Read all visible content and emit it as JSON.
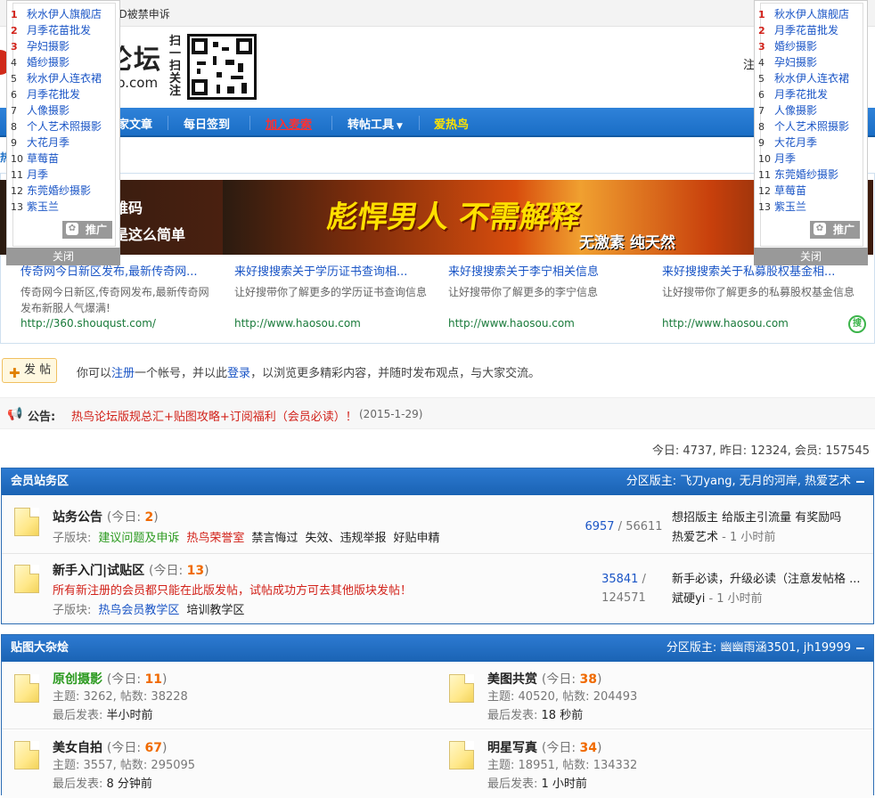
{
  "topbar": {
    "text": "ID被禁申诉"
  },
  "header": {
    "logo_text": "论坛",
    "logo_sub": "iao.com",
    "qr_side": "扫一扫关注",
    "right_text": "注"
  },
  "nav": {
    "items": [
      "家文章",
      "每日签到",
      "加入麦索",
      "转帖工具",
      "爱热鸟"
    ]
  },
  "hot_label": "热",
  "float_left": {
    "items": [
      {
        "n": "1",
        "label": "秋水伊人旗舰店"
      },
      {
        "n": "2",
        "label": "月季花苗批发"
      },
      {
        "n": "3",
        "label": "孕妇摄影"
      },
      {
        "n": "4",
        "label": "婚纱摄影"
      },
      {
        "n": "5",
        "label": "秋水伊人连衣裙"
      },
      {
        "n": "6",
        "label": "月季花批发"
      },
      {
        "n": "7",
        "label": "人像摄影"
      },
      {
        "n": "8",
        "label": "个人艺术照摄影"
      },
      {
        "n": "9",
        "label": "大花月季"
      },
      {
        "n": "10",
        "label": "草莓苗"
      },
      {
        "n": "11",
        "label": "月季"
      },
      {
        "n": "12",
        "label": "东莞婚纱摄影"
      },
      {
        "n": "13",
        "label": "紫玉兰"
      }
    ],
    "promo": "推广",
    "close": "关闭"
  },
  "float_right": {
    "items": [
      {
        "n": "1",
        "label": "秋水伊人旗舰店"
      },
      {
        "n": "2",
        "label": "月季花苗批发"
      },
      {
        "n": "3",
        "label": "婚纱摄影"
      },
      {
        "n": "4",
        "label": "孕妇摄影"
      },
      {
        "n": "5",
        "label": "秋水伊人连衣裙"
      },
      {
        "n": "6",
        "label": "月季花批发"
      },
      {
        "n": "7",
        "label": "人像摄影"
      },
      {
        "n": "8",
        "label": "个人艺术照摄影"
      },
      {
        "n": "9",
        "label": "大花月季"
      },
      {
        "n": "10",
        "label": "月季"
      },
      {
        "n": "11",
        "label": "东莞婚纱摄影"
      },
      {
        "n": "12",
        "label": "草莓苗"
      },
      {
        "n": "13",
        "label": "紫玉兰"
      }
    ],
    "promo": "推广",
    "close": "关闭"
  },
  "banner": {
    "left_line1": "扫描二维码",
    "left_line2": "性福就是这么简单",
    "headline": "彪悍男人 不需解释",
    "tag": "无激素 纯天然"
  },
  "ads": [
    {
      "title": "传奇网今日新区发布,最新传奇网...",
      "desc": "传奇网今日新区,传奇网发布,最新传奇网发布新服人气爆满!",
      "url": "http://360.shouqust.com/"
    },
    {
      "title": "来好搜搜索关于学历证书查询相...",
      "desc": "让好搜带你了解更多的学历证书查询信息",
      "url": "http://www.haosou.com"
    },
    {
      "title": "来好搜搜索关于李宁相关信息",
      "desc": "让好搜带你了解更多的李宁信息",
      "url": "http://www.haosou.com"
    },
    {
      "title": "来好搜搜索关于私募股权基金相...",
      "desc": "让好搜带你了解更多的私募股权基金信息",
      "url": "http://www.haosou.com"
    }
  ],
  "so_icon": "搜",
  "post": {
    "button": "发 帖",
    "pre": "你可以",
    "register": "注册",
    "mid": "一个帐号，并以此",
    "login": "登录",
    "post": "，以浏览更多精彩内容，并随时发布观点，与大家交流。"
  },
  "notice": {
    "label": "公告:",
    "text": "热鸟论坛版规总汇+贴图攻略+订阅福利（会员必读）！",
    "date": "(2015-1-29)"
  },
  "stats": "今日: 4737, 昨日: 12324, 会员: 157545",
  "section1": {
    "title": "会员站务区",
    "mods_label": "分区版主:",
    "mods": "飞刀yang, 无月的河岸, 热爱艺术",
    "forums": [
      {
        "name": "站务公告",
        "today_label": "(今日: ",
        "today": "2",
        "today_end": ")",
        "sub_label": "子版块:",
        "subs": [
          "建议问题及申诉",
          "热鸟荣誉室",
          "禁言悔过",
          "失效、违规举报",
          "好贴申精"
        ],
        "threads": "6957",
        "posts": "56611",
        "last_title": "想招版主 给版主引流量 有奖励吗",
        "last_user": "热爱艺术",
        "last_time": "- 1 小时前"
      },
      {
        "name": "新手入门|试贴区",
        "today_label": "(今日: ",
        "today": "13",
        "today_end": ")",
        "note": "所有新注册的会员都只能在此版发帖，试帖成功方可去其他版块发帖！",
        "sub_label": "子版块:",
        "subs": [
          "热鸟会员教学区",
          "培训教学区"
        ],
        "threads": "35841",
        "posts": "124571",
        "last_title": "新手必读，升级必读（注意发帖格 ...",
        "last_user": "斌硬yi",
        "last_time": "- 1 小时前"
      }
    ]
  },
  "section2": {
    "title": "贴图大杂烩",
    "mods_label": "分区版主:",
    "mods": "幽幽雨涵3501, jh19999",
    "forums": [
      {
        "name": "原创摄影",
        "today": "11",
        "topics_label": "主题:",
        "topics": "3262",
        "posts_label": "帖数:",
        "posts": "38228",
        "last_label": "最后发表:",
        "last": "半小时前"
      },
      {
        "name": "美图共赏",
        "today": "38",
        "topics_label": "主题:",
        "topics": "40520",
        "posts_label": "帖数:",
        "posts": "204493",
        "last_label": "最后发表:",
        "last": "18 秒前"
      },
      {
        "name": "美女自拍",
        "today": "67",
        "topics_label": "主题:",
        "topics": "3557",
        "posts_label": "帖数:",
        "posts": "295095",
        "last_label": "最后发表:",
        "last": "8 分钟前"
      },
      {
        "name": "明星写真",
        "today": "34",
        "topics_label": "主题:",
        "topics": "18951",
        "posts_label": "帖数:",
        "posts": "134332",
        "last_label": "最后发表:",
        "last": "1 小时前"
      }
    ],
    "today_label": "(今日: ",
    "today_end": ")"
  },
  "colors": {
    "nav_blue": "#1a6ec6",
    "red": "#d2221a",
    "orange": "#f06a00",
    "green": "#2b9a1f"
  }
}
